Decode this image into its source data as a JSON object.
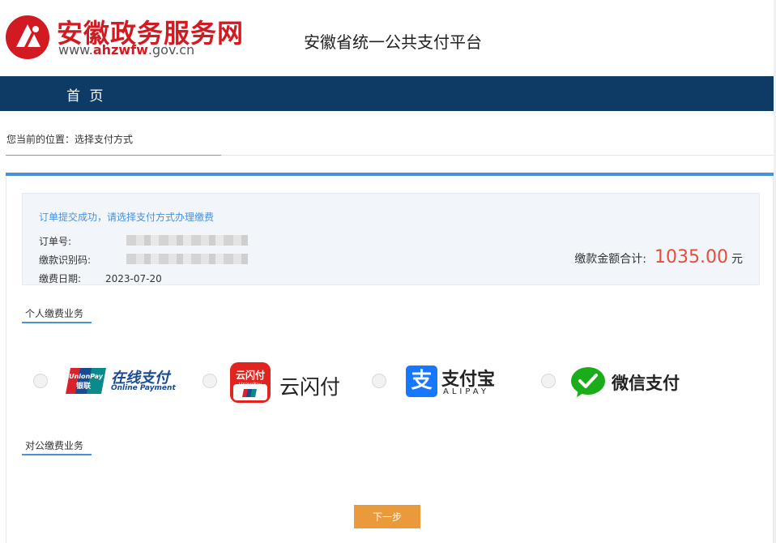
{
  "header": {
    "site_name": "安徽政务服务网",
    "url_prefix": "www.",
    "url_brand": "ahzwfw",
    "url_suffix": ".gov.cn",
    "platform_title": "安徽省统一公共支付平台"
  },
  "nav": {
    "home": "首 页"
  },
  "breadcrumb": {
    "text": "您当前的位置：选择支付方式"
  },
  "order": {
    "message": "订单提交成功，请选择支付方式办理缴费",
    "order_no_label": "订单号:",
    "payment_code_label": "缴款识别码:",
    "date_label": "缴费日期:",
    "date_value": "2023-07-20",
    "total_label": "缴款金额合计:",
    "total_amount": "1035.00",
    "total_unit": "元"
  },
  "sections": {
    "personal": "个人缴费业务",
    "corporate": "对公缴费业务"
  },
  "payment_methods": {
    "unionpay_cn": "在线支付",
    "unionpay_en": "Online Payment",
    "unionpay_badge_top": "UnionPay",
    "unionpay_badge_bottom": "银联",
    "quickpass_badge": "云闪付",
    "quickpass_badge_sub": "UnionPay",
    "quickpass_text": "云闪付",
    "alipay_icon": "支",
    "alipay_cn": "支付宝",
    "alipay_en": "ALIPAY",
    "wechat_cn": "微信支付"
  },
  "buttons": {
    "next": "下一步"
  },
  "colors": {
    "brand_red": "#d21a22",
    "nav_blue": "#0d3b66",
    "accent_blue": "#4a90d9",
    "amount_red": "#e74c3c",
    "button_orange": "#ea9a3a"
  }
}
